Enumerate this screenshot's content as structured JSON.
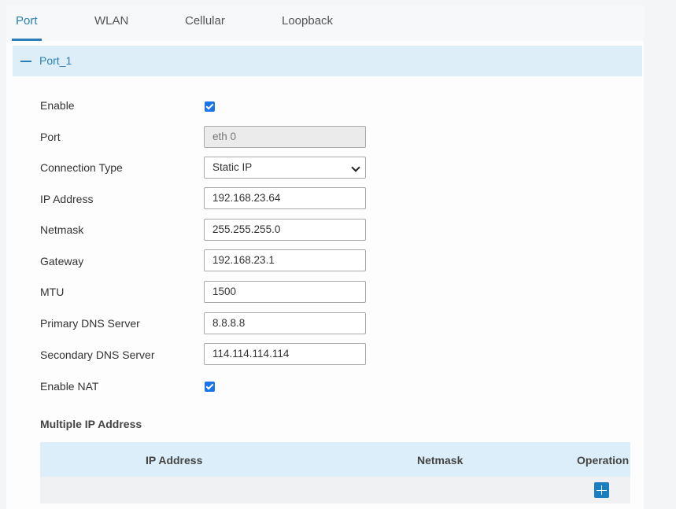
{
  "tabs": [
    "Port",
    "WLAN",
    "Cellular",
    "Loopback"
  ],
  "section": {
    "title": "Port_1"
  },
  "form": {
    "enable_label": "Enable",
    "enable_checked": true,
    "port_label": "Port",
    "port_value": "eth 0",
    "conn_type_label": "Connection Type",
    "conn_type_value": "Static IP",
    "ip_label": "IP Address",
    "ip_value": "192.168.23.64",
    "netmask_label": "Netmask",
    "netmask_value": "255.255.255.0",
    "gateway_label": "Gateway",
    "gateway_value": "192.168.23.1",
    "mtu_label": "MTU",
    "mtu_value": "1500",
    "dns1_label": "Primary DNS Server",
    "dns1_value": "8.8.8.8",
    "dns2_label": "Secondary DNS Server",
    "dns2_value": "114.114.114.114",
    "nat_label": "Enable NAT",
    "nat_checked": true
  },
  "multi_ip": {
    "title": "Multiple IP Address",
    "columns": [
      "IP Address",
      "Netmask",
      "Operation"
    ]
  }
}
